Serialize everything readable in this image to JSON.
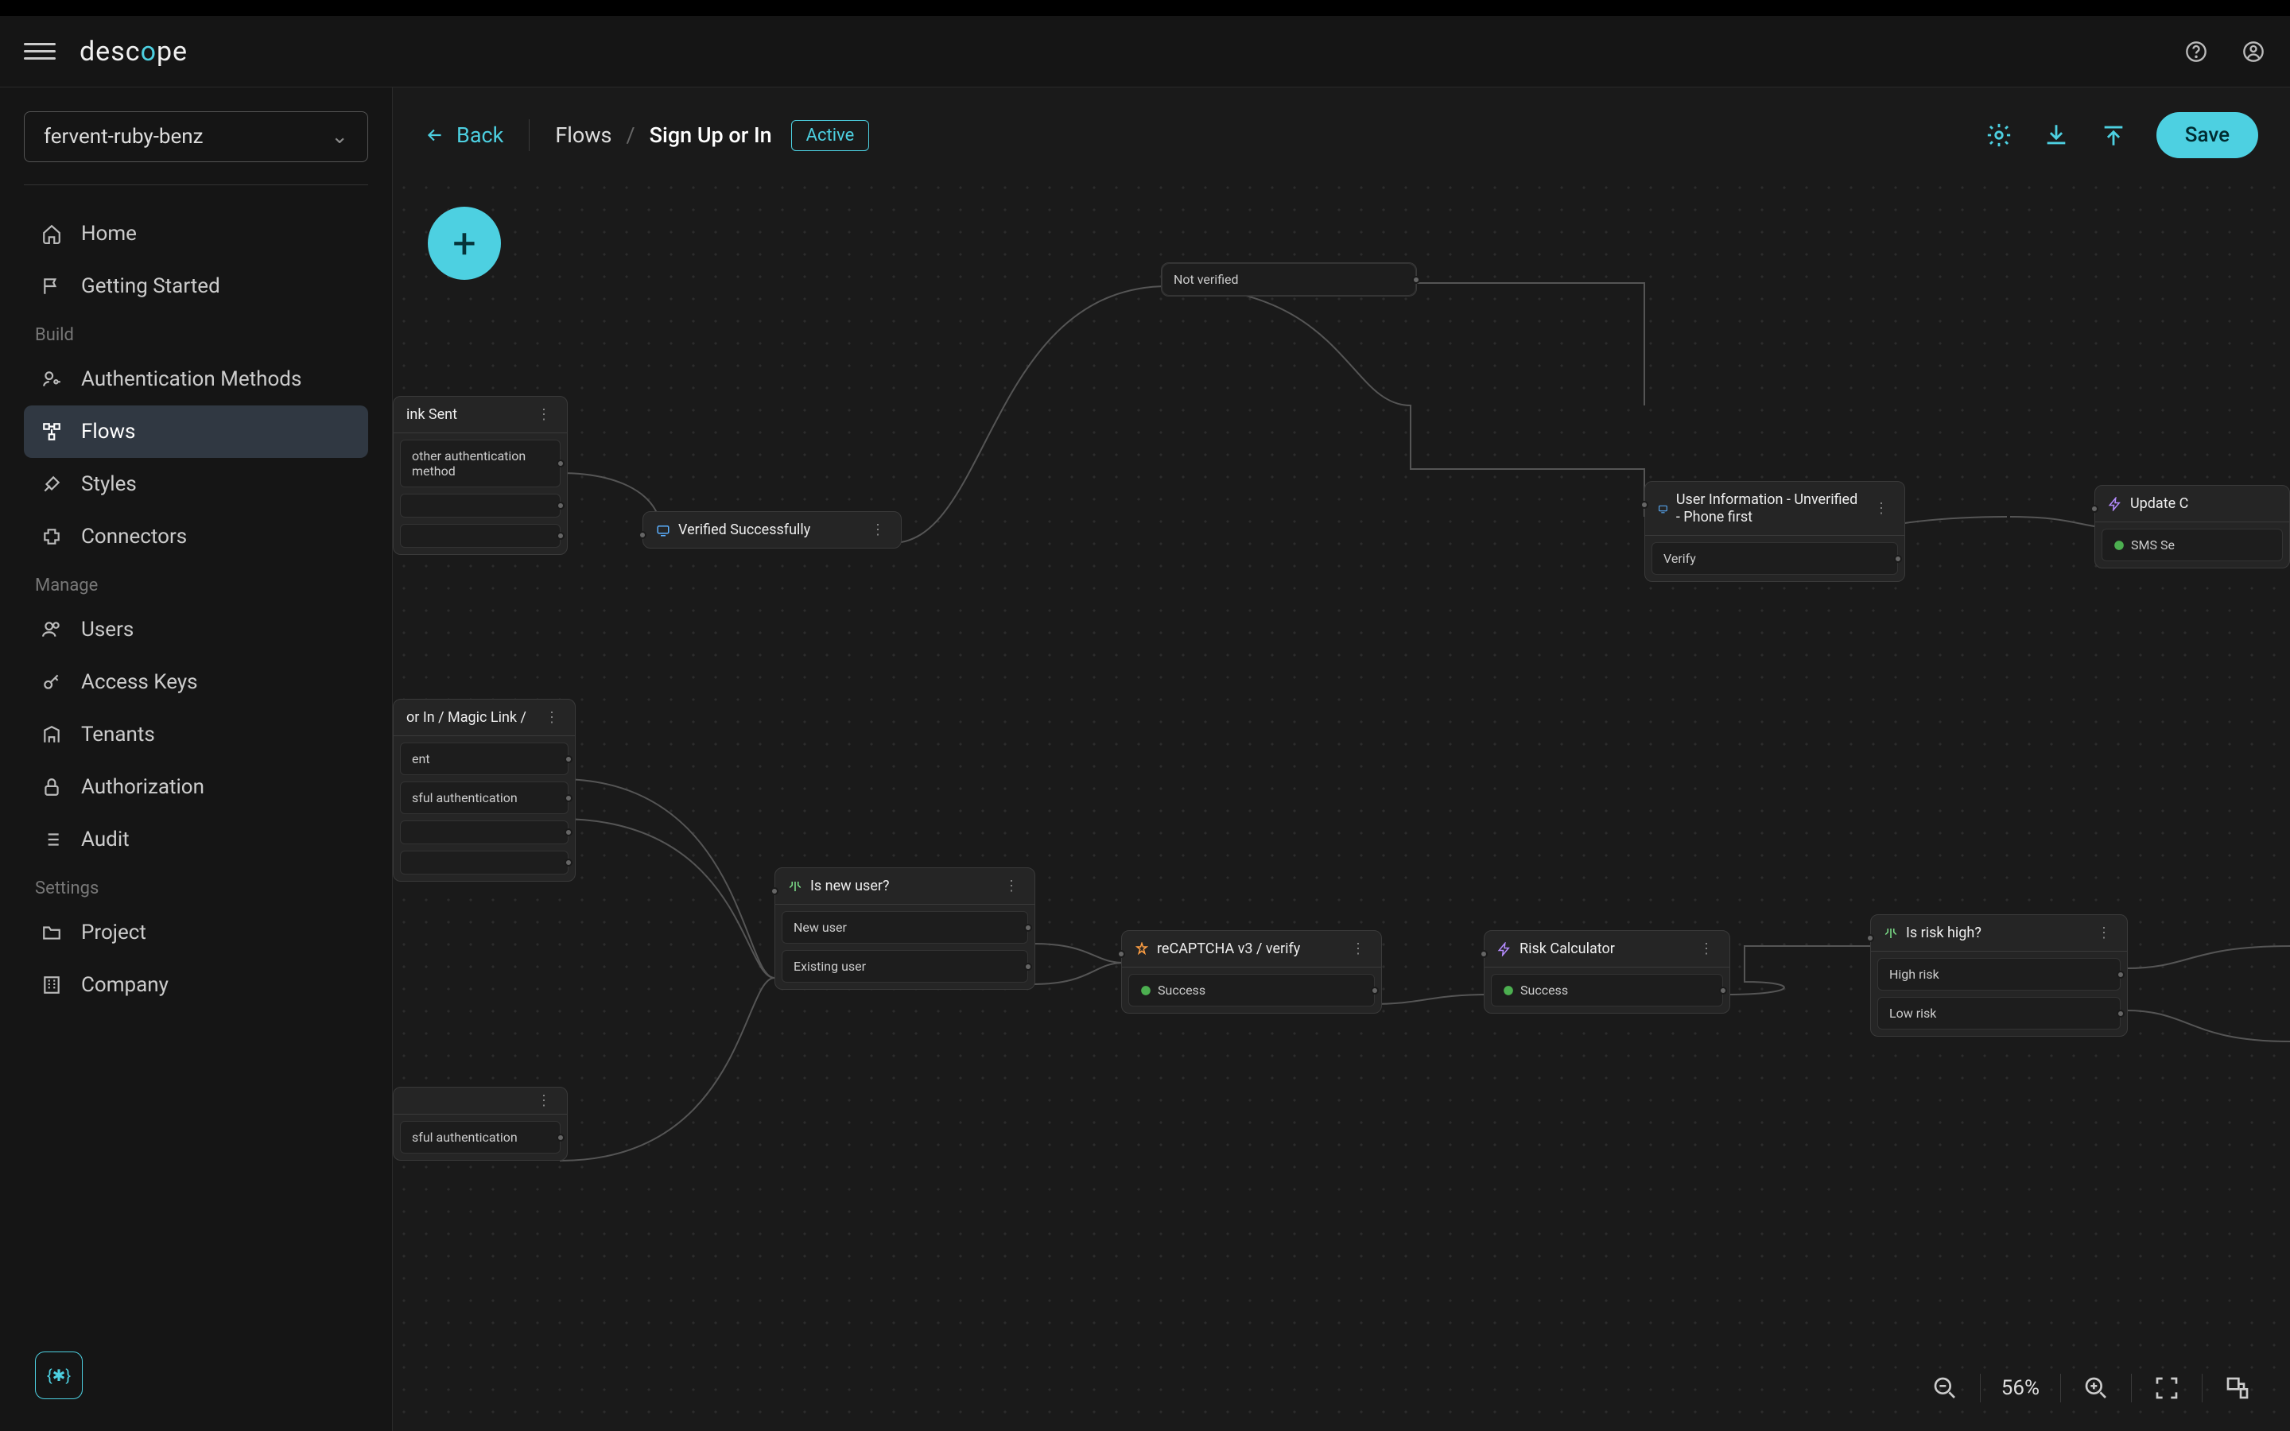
{
  "header": {
    "logo_text_pre": "desc",
    "logo_text_accent": "o",
    "logo_text_post": "pe"
  },
  "sidebar": {
    "project_name": "fervent-ruby-benz",
    "nav_top": [
      {
        "label": "Home"
      },
      {
        "label": "Getting Started"
      }
    ],
    "section_build": "Build",
    "nav_build": [
      {
        "label": "Authentication Methods"
      },
      {
        "label": "Flows"
      },
      {
        "label": "Styles"
      },
      {
        "label": "Connectors"
      }
    ],
    "section_manage": "Manage",
    "nav_manage": [
      {
        "label": "Users"
      },
      {
        "label": "Access Keys"
      },
      {
        "label": "Tenants"
      },
      {
        "label": "Authorization"
      },
      {
        "label": "Audit"
      }
    ],
    "section_settings": "Settings",
    "nav_settings": [
      {
        "label": "Project"
      },
      {
        "label": "Company"
      }
    ]
  },
  "toolbar": {
    "back_label": "Back",
    "breadcrumb_root": "Flows",
    "breadcrumb_sep": "/",
    "breadcrumb_current": "Sign Up or In",
    "status_badge": "Active",
    "save_label": "Save"
  },
  "bottombar": {
    "zoom_label": "56%"
  },
  "nodes": {
    "not_verified": {
      "row": "Not verified"
    },
    "link_sent": {
      "title": "ink Sent",
      "row1": "other authentication method"
    },
    "verified": {
      "title": "Verified Successfully"
    },
    "user_info": {
      "title": "User Information - Unverified - Phone first",
      "row1": "Verify"
    },
    "update_c": {
      "title": "Update C",
      "row1": "SMS Se"
    },
    "magic_link": {
      "title": "or In / Magic Link /",
      "row1": "ent",
      "row2": "sful authentication"
    },
    "auth_lower": {
      "row1": "sful authentication"
    },
    "is_new": {
      "title": "Is new user?",
      "row1": "New user",
      "row2": "Existing user"
    },
    "recaptcha": {
      "title": "reCAPTCHA v3 / verify",
      "row1": "Success"
    },
    "risk_calc": {
      "title": "Risk Calculator",
      "row1": "Success"
    },
    "risk_high": {
      "title": "Is risk high?",
      "row1": "High risk",
      "row2": "Low risk"
    }
  },
  "chat_fab": {
    "symbol": "{✱}"
  }
}
